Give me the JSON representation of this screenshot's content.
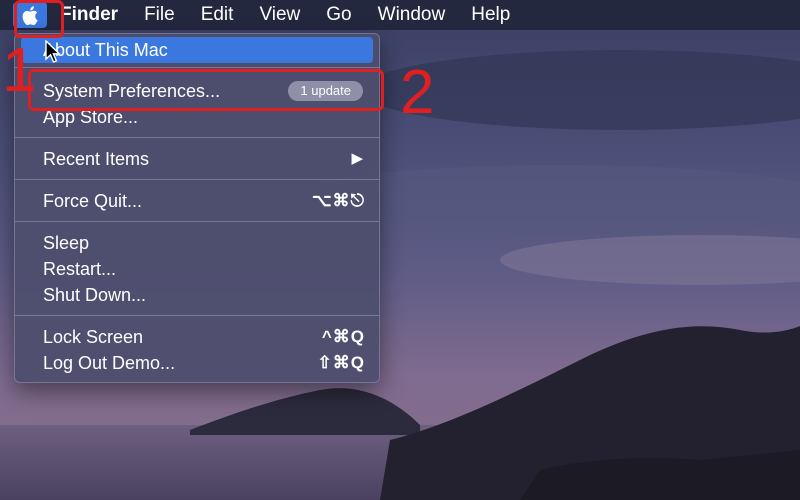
{
  "menubar": {
    "apple_menu_icon": "apple-logo-icon",
    "items": [
      "Finder",
      "File",
      "Edit",
      "View",
      "Go",
      "Window",
      "Help"
    ]
  },
  "apple_menu": {
    "about": "About This Mac",
    "system_preferences": "System Preferences...",
    "update_badge": "1 update",
    "app_store": "App Store...",
    "recent_items": "Recent Items",
    "recent_items_arrow": "▶",
    "force_quit": "Force Quit...",
    "force_quit_shortcut": "⌥⌘⎋",
    "sleep": "Sleep",
    "restart": "Restart...",
    "shut_down": "Shut Down...",
    "lock_screen": "Lock Screen",
    "lock_screen_shortcut": "^⌘Q",
    "log_out": "Log Out Demo...",
    "log_out_shortcut": "⇧⌘Q"
  },
  "annotations": {
    "step1": "1",
    "step2": "2",
    "color": "#e02020"
  },
  "colors": {
    "menubar": "#24283f",
    "highlight": "#3a78e0",
    "menu_bg": "#4e4e6e"
  }
}
